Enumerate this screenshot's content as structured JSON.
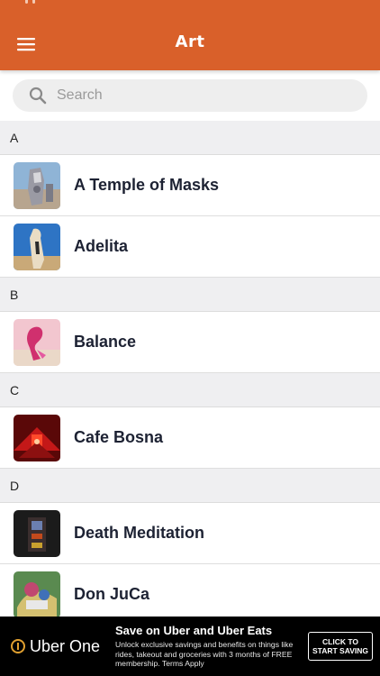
{
  "theme": {
    "brand": "#d9602a"
  },
  "header": {
    "title": "Art",
    "menu_icon": "hamburger-menu-icon"
  },
  "search": {
    "placeholder": "Search",
    "value": "",
    "icon": "search-icon"
  },
  "sections": [
    {
      "letter": "A",
      "items": [
        {
          "label": "A Temple of Masks"
        },
        {
          "label": "Adelita"
        }
      ]
    },
    {
      "letter": "B",
      "items": [
        {
          "label": "Balance"
        }
      ]
    },
    {
      "letter": "C",
      "items": [
        {
          "label": "Cafe Bosna"
        }
      ]
    },
    {
      "letter": "D",
      "items": [
        {
          "label": "Death Meditation"
        },
        {
          "label": "Don JuCa"
        }
      ]
    }
  ],
  "ad": {
    "brand": "Uber One",
    "headline": "Save on Uber and Uber Eats",
    "body": "Unlock exclusive savings and benefits on things like rides, takeout and groceries with 3 months of FREE membership. Terms Apply",
    "cta_line1": "CLICK TO",
    "cta_line2": "START SAVING"
  }
}
